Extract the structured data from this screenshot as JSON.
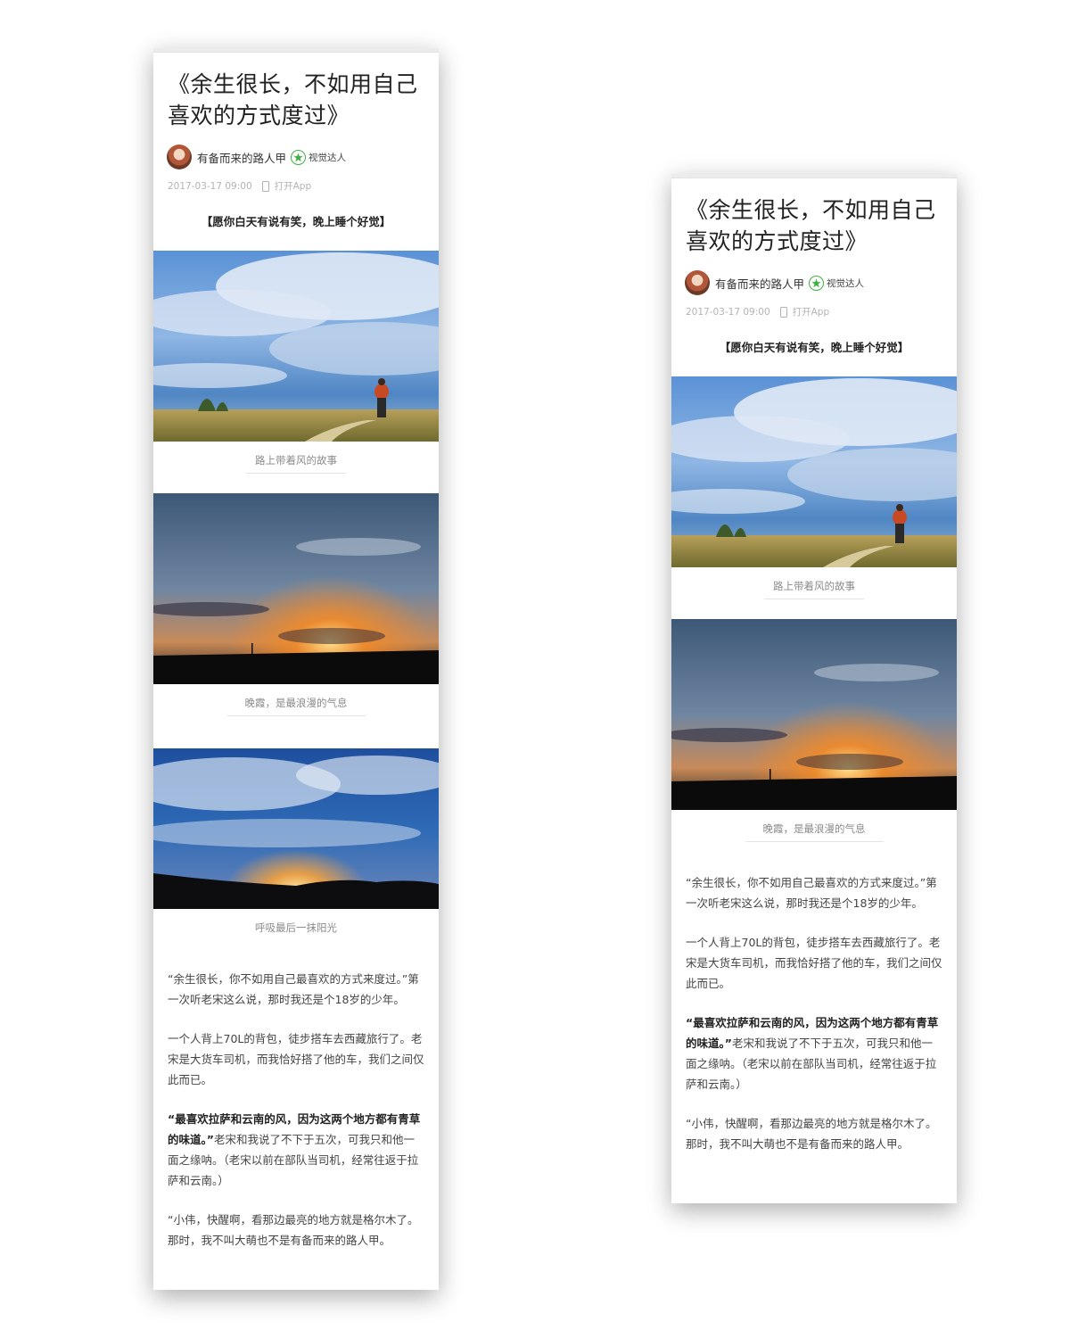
{
  "article": {
    "title_line1": "《余生很长，不如用自己",
    "title_line2": "喜欢的方式度过》",
    "author_name": "有备而来的路人甲",
    "badge_label": "视觉达人",
    "date": "2017-03-17 09:00",
    "open_app_label": "打开App",
    "intro": "【愿你白天有说有笑，晚上睡个好觉】",
    "captions": [
      "路上带着风的故事",
      "晚霞，是最浪漫的气息",
      "呼吸最后一抹阳光"
    ],
    "paragraphs": [
      {
        "bold": "",
        "text": "“余生很长，你不如用自己最喜欢的方式来度过。”第一次听老宋这么说，那时我还是个18岁的少年。"
      },
      {
        "bold": "",
        "text": "一个人背上70L的背包，徒步搭车去西藏旅行了。老宋是大货车司机，而我恰好搭了他的车，我们之间仅此而已。"
      },
      {
        "bold": "“最喜欢拉萨和云南的风，因为这两个地方都有青草的味道。”",
        "text": "老宋和我说了不下于五次，可我只和他一面之缘呐。（老宋以前在部队当司机，经常往返于拉萨和云南。）"
      },
      {
        "bold": "",
        "text": "“小伟，快醒啊，看那边最亮的地方就是格尔木了。那时，我不叫大萌也不是有备而来的路人甲。"
      }
    ]
  },
  "colors": {
    "badge_green": "#3cb043",
    "sky_blue": "#2f7fc6",
    "sunset_orange": "#f08a2a"
  },
  "icons": {
    "badge": "star-badge-icon",
    "open_app": "phone-icon"
  }
}
